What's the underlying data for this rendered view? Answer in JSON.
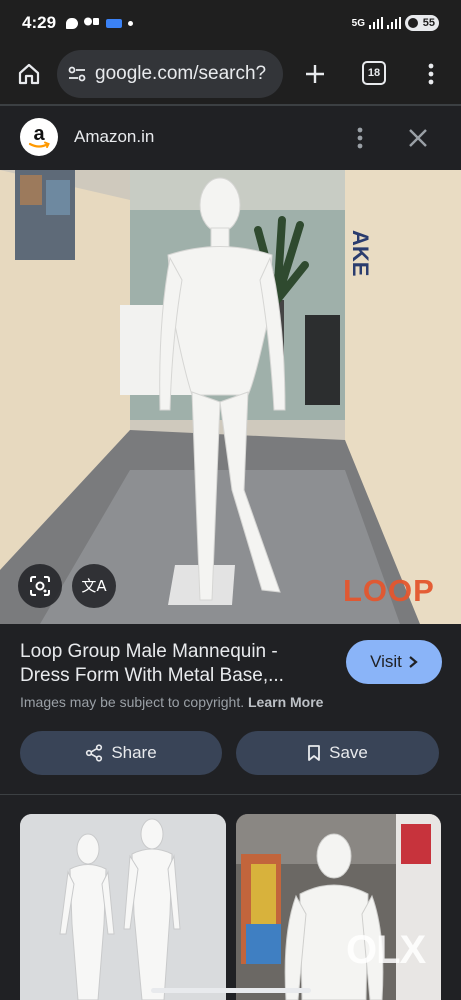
{
  "status_bar": {
    "time": "4:29",
    "network": "5G",
    "battery": "55",
    "icons": [
      "message-icon",
      "teams-icon",
      "mail-icon",
      "notification-dot-icon",
      "signal-icon",
      "battery-icon"
    ]
  },
  "browser": {
    "url": "google.com/search?",
    "tab_count": "18",
    "icons": [
      "home-icon",
      "site-info-icon",
      "plus-icon",
      "tabs-icon",
      "more-vert-icon"
    ]
  },
  "source": {
    "name": "Amazon.in",
    "logo_letter": "a",
    "icons": [
      "more-vert-icon",
      "close-icon"
    ]
  },
  "image": {
    "watermark": "LOOP",
    "overlay_buttons": [
      "google-lens-icon",
      "translate-icon"
    ],
    "translate_glyph": "文A"
  },
  "result": {
    "title": "Loop Group Male Mannequin -\nDress Form With Metal Base,...",
    "visit_label": "Visit",
    "copyright_text": "Images may be subject to copyright.",
    "learn_more": "Learn More"
  },
  "actions": {
    "share_label": "Share",
    "save_label": "Save"
  },
  "related": {
    "thumb2_watermark": "OLX"
  },
  "colors": {
    "background": "#202124",
    "accent": "#8ab4f8",
    "action_button": "#394457",
    "loop_brand": "#e4572e"
  }
}
